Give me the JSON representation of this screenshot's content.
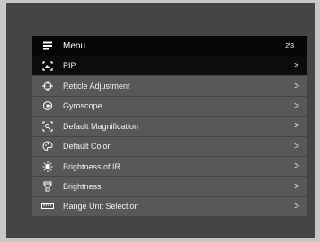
{
  "menu": {
    "title": "Menu",
    "page": "2/3",
    "header_icon": "hamburger-icon",
    "items": [
      {
        "label": "PIP",
        "icon": "pip-icon",
        "selected": true
      },
      {
        "label": "Reticle Adjustment",
        "icon": "crosshair-icon"
      },
      {
        "label": "Gyroscope",
        "icon": "gyroscope-icon"
      },
      {
        "label": "Default Magnification",
        "icon": "zoom-icon"
      },
      {
        "label": "Default Color",
        "icon": "palette-icon"
      },
      {
        "label": "Brightness of IR",
        "icon": "ir-brightness-icon"
      },
      {
        "label": "Brightness",
        "icon": "flashlight-icon"
      },
      {
        "label": "Range Unit Selection",
        "icon": "ruler-icon"
      }
    ],
    "chevron": ">"
  }
}
